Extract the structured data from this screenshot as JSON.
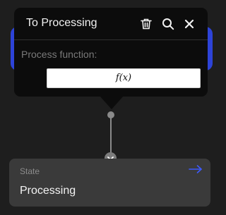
{
  "popover": {
    "title": "To Processing",
    "field_label": "Process function:",
    "function_button_label": "f(x)",
    "icons": [
      "trash-icon",
      "search-icon",
      "close-icon"
    ]
  },
  "state_node": {
    "label": "State",
    "name": "Processing",
    "icon": "arrow-right-icon"
  },
  "connector": {
    "icon": "chevron-down-icon"
  },
  "colors": {
    "background": "#1e1e1e",
    "popover": "#0c0c0c",
    "accent": "#2d43d8",
    "node": "#3a3a3a",
    "connector": "#8a8a8a"
  }
}
